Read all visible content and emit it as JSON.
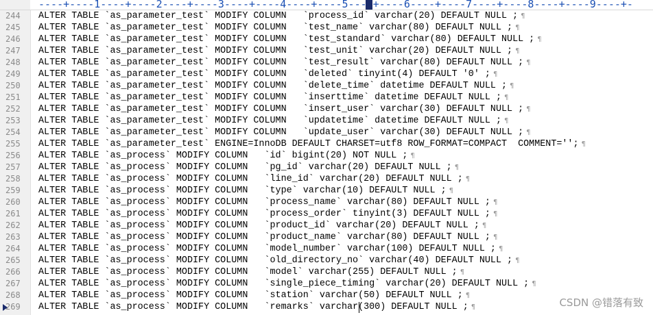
{
  "ruler": {
    "text": "----+----1----+----2----+----3----+----4----+----5----+----6----+----7----+----8----+----9----+-"
  },
  "lines": [
    {
      "num": "244",
      "text": "ALTER TABLE `as_parameter_test` MODIFY COLUMN   `process_id` varchar(20) DEFAULT NULL ;"
    },
    {
      "num": "245",
      "text": "ALTER TABLE `as_parameter_test` MODIFY COLUMN   `test_name` varchar(80) DEFAULT NULL ;"
    },
    {
      "num": "246",
      "text": "ALTER TABLE `as_parameter_test` MODIFY COLUMN   `test_standard` varchar(80) DEFAULT NULL ;"
    },
    {
      "num": "247",
      "text": "ALTER TABLE `as_parameter_test` MODIFY COLUMN   `test_unit` varchar(20) DEFAULT NULL ;"
    },
    {
      "num": "248",
      "text": "ALTER TABLE `as_parameter_test` MODIFY COLUMN   `test_result` varchar(80) DEFAULT NULL ;"
    },
    {
      "num": "249",
      "text": "ALTER TABLE `as_parameter_test` MODIFY COLUMN   `deleted` tinyint(4) DEFAULT '0' ;"
    },
    {
      "num": "250",
      "text": "ALTER TABLE `as_parameter_test` MODIFY COLUMN   `delete_time` datetime DEFAULT NULL ;"
    },
    {
      "num": "251",
      "text": "ALTER TABLE `as_parameter_test` MODIFY COLUMN   `inserttime` datetime DEFAULT NULL ;"
    },
    {
      "num": "252",
      "text": "ALTER TABLE `as_parameter_test` MODIFY COLUMN   `insert_user` varchar(30) DEFAULT NULL ;"
    },
    {
      "num": "253",
      "text": "ALTER TABLE `as_parameter_test` MODIFY COLUMN   `updatetime` datetime DEFAULT NULL ;"
    },
    {
      "num": "254",
      "text": "ALTER TABLE `as_parameter_test` MODIFY COLUMN   `update_user` varchar(30) DEFAULT NULL ;"
    },
    {
      "num": "255",
      "text": "ALTER TABLE `as_parameter_test` ENGINE=InnoDB DEFAULT CHARSET=utf8 ROW_FORMAT=COMPACT  COMMENT='';"
    },
    {
      "num": "256",
      "text": "ALTER TABLE `as_process` MODIFY COLUMN   `id` bigint(20) NOT NULL ;"
    },
    {
      "num": "257",
      "text": "ALTER TABLE `as_process` MODIFY COLUMN   `pg_id` varchar(20) DEFAULT NULL ;"
    },
    {
      "num": "258",
      "text": "ALTER TABLE `as_process` MODIFY COLUMN   `line_id` varchar(20) DEFAULT NULL ;"
    },
    {
      "num": "259",
      "text": "ALTER TABLE `as_process` MODIFY COLUMN   `type` varchar(10) DEFAULT NULL ;"
    },
    {
      "num": "260",
      "text": "ALTER TABLE `as_process` MODIFY COLUMN   `process_name` varchar(80) DEFAULT NULL ;"
    },
    {
      "num": "261",
      "text": "ALTER TABLE `as_process` MODIFY COLUMN   `process_order` tinyint(3) DEFAULT NULL ;"
    },
    {
      "num": "262",
      "text": "ALTER TABLE `as_process` MODIFY COLUMN   `product_id` varchar(20) DEFAULT NULL ;"
    },
    {
      "num": "263",
      "text": "ALTER TABLE `as_process` MODIFY COLUMN   `product_name` varchar(80) DEFAULT NULL ;"
    },
    {
      "num": "264",
      "text": "ALTER TABLE `as_process` MODIFY COLUMN   `model_number` varchar(100) DEFAULT NULL ;"
    },
    {
      "num": "265",
      "text": "ALTER TABLE `as_process` MODIFY COLUMN   `old_directory_no` varchar(40) DEFAULT NULL ;"
    },
    {
      "num": "266",
      "text": "ALTER TABLE `as_process` MODIFY COLUMN   `model` varchar(255) DEFAULT NULL ;"
    },
    {
      "num": "267",
      "text": "ALTER TABLE `as_process` MODIFY COLUMN   `single_piece_timing` varchar(20) DEFAULT NULL ;"
    },
    {
      "num": "268",
      "text": "ALTER TABLE `as_process` MODIFY COLUMN   `station` varchar(50) DEFAULT NULL ;"
    },
    {
      "num": "269",
      "text": "ALTER TABLE `as_process` MODIFY COLUMN   `remarks` varchar(300) DEFAULT NULL ;"
    }
  ],
  "pilcrow": "¶",
  "watermark": "CSDN @错落有致",
  "icons": {
    "bookmark": "bookmark-icon",
    "line_end": "pilcrow-icon"
  },
  "colors": {
    "ruler": "#1a4fb4",
    "line_number": "#8a8a8a",
    "code": "#000000",
    "gutter_bg": "#f0f0f0"
  }
}
